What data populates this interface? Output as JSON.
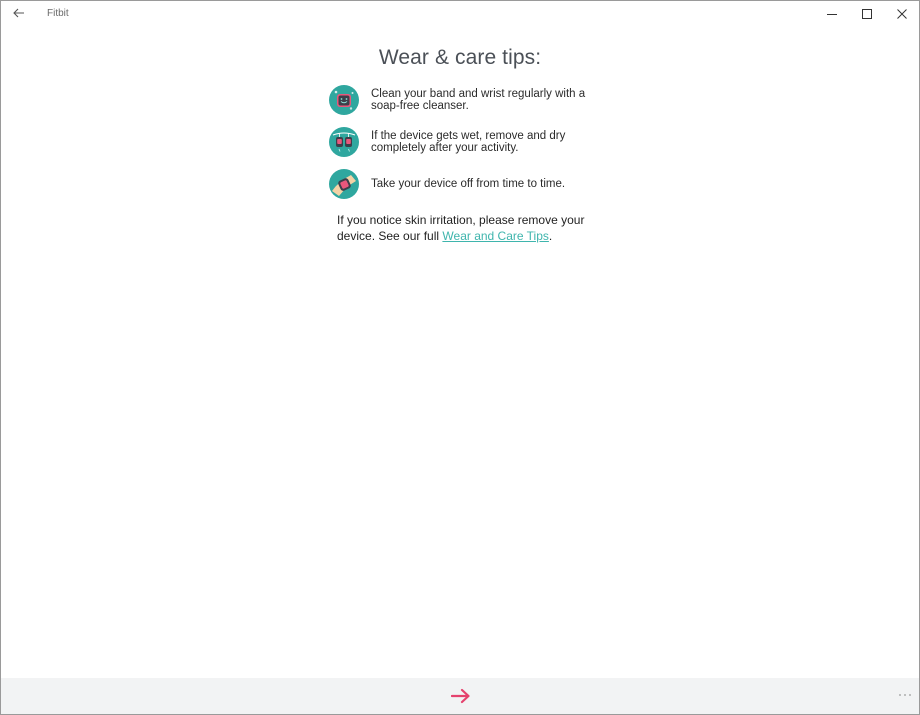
{
  "titlebar": {
    "app_title": "Fitbit",
    "back_icon": "arrow-left-icon",
    "minimize_icon": "minimize-icon",
    "maximize_icon": "maximize-icon",
    "close_icon": "close-icon"
  },
  "main": {
    "title": "Wear & care tips:",
    "tips": [
      {
        "icon": "clean-band-icon",
        "text": "Clean your band and wrist regularly with a soap-free cleanser."
      },
      {
        "icon": "wet-device-icon",
        "text": "If the device gets wet, remove and dry completely after your activity."
      },
      {
        "icon": "take-off-device-icon",
        "text": "Take your device off from time to time."
      }
    ],
    "note": {
      "prefix": "If you notice skin irritation, please remove your device. See our full ",
      "link": "Wear and Care Tips",
      "suffix": "."
    }
  },
  "bottombar": {
    "next_icon": "arrow-right-icon",
    "more_icon": "more-icon"
  },
  "colors": {
    "accent_teal": "#3fb5ad",
    "arrow_pink": "#e5426e",
    "bottom_bar": "#f2f3f4",
    "title_text": "#4b5057"
  }
}
